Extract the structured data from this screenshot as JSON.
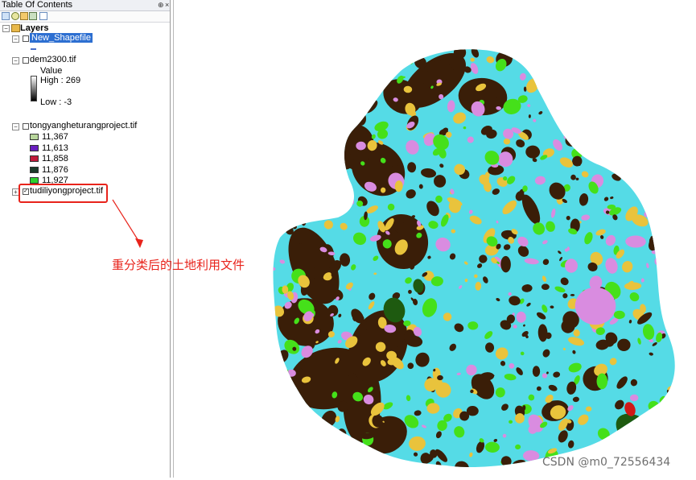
{
  "toc": {
    "title": "Table Of Contents",
    "pin_glyph": "§ ×",
    "root": "Layers",
    "layers": [
      {
        "name": "New_Shapefile",
        "selected": true,
        "checked": false
      },
      {
        "name": "dem2300.tif",
        "checked": false,
        "legend_title": "Value",
        "high": "High : 269",
        "low": "Low : -3"
      },
      {
        "name": "tongyangheturangproject.tif",
        "checked": false,
        "classes": [
          {
            "label": "11,367",
            "color": "#b8d69c"
          },
          {
            "label": "11,613",
            "color": "#6a1fc0"
          },
          {
            "label": "11,858",
            "color": "#c01a3a"
          },
          {
            "label": "11,876",
            "color": "#1c3b2a"
          },
          {
            "label": "11,927",
            "color": "#2ed12e"
          }
        ]
      },
      {
        "name": "tudiliyongproject.tif",
        "checked": true
      }
    ]
  },
  "annotation": {
    "text": "重分类后的土地利用文件",
    "color": "#e8231b"
  },
  "watermark": "CSDN @m0_72556434",
  "map": {
    "colors": {
      "water": "#55dbe6",
      "forest": "#3a1e08",
      "urban": "#d98ce0",
      "farm": "#e9c33c",
      "grass": "#45e01a",
      "dark_green": "#1e5a10",
      "red": "#d01818"
    }
  }
}
